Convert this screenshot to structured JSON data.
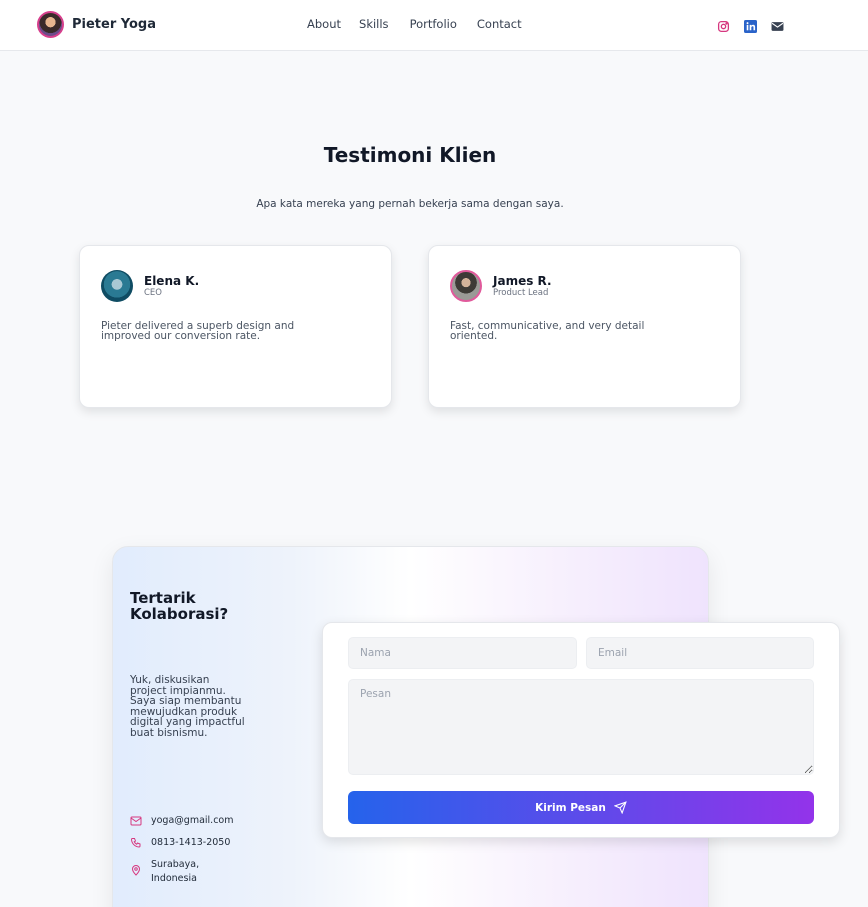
{
  "brand": {
    "name": "Pieter Yoga"
  },
  "nav": {
    "items": [
      "About",
      "Skills",
      "Portfolio",
      "Contact"
    ]
  },
  "socials": [
    "instagram-icon",
    "linkedin-icon",
    "mail-icon"
  ],
  "colors": {
    "accent_blue": "#2563eb",
    "accent_purple": "#9333ea",
    "instagram": "#d6377f",
    "linkedin": "#2a63c9",
    "contact_icon": "#d6377f"
  },
  "testimonials": {
    "title": "Testimoni Klien",
    "subtitle": "Apa kata mereka yang pernah bekerja sama dengan saya.",
    "items": [
      {
        "name": "Elena K.",
        "role": "CEO",
        "quote": "Pieter delivered a superb design and improved our conversion rate."
      },
      {
        "name": "James R.",
        "role": "Product Lead",
        "quote": "Fast, communicative, and very detail oriented."
      }
    ]
  },
  "contact": {
    "title": "Tertarik Kolaborasi?",
    "description": "Yuk, diskusikan project impianmu. Saya siap membantu mewujudkan produk digital yang impactful buat bisnismu.",
    "email": "yoga@gmail.com",
    "phone": "0813-1413-2050",
    "location": "Surabaya, Indonesia"
  },
  "form": {
    "name_placeholder": "Nama",
    "email_placeholder": "Email",
    "message_placeholder": "Pesan",
    "submit_label": "Kirim Pesan"
  }
}
